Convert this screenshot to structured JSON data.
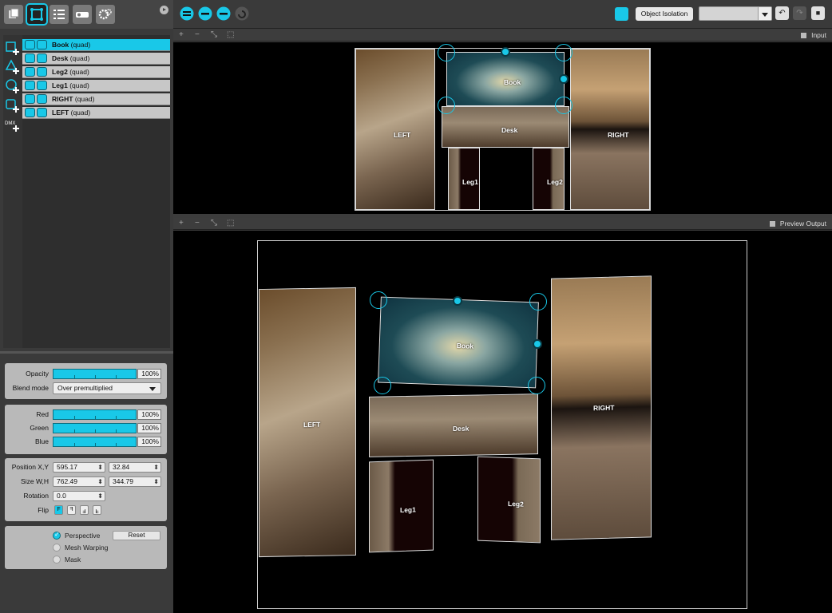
{
  "left_tabs": [
    {
      "icon": "layers-icon"
    },
    {
      "icon": "quad-mapping-icon",
      "active": true
    },
    {
      "icon": "list-icon"
    },
    {
      "icon": "projector-icon"
    },
    {
      "icon": "settings-icon"
    }
  ],
  "layers": [
    {
      "name": "Book",
      "type": "(quad)",
      "selected": true
    },
    {
      "name": "Desk",
      "type": "(quad)"
    },
    {
      "name": "Leg2",
      "type": "(quad)"
    },
    {
      "name": "Leg1",
      "type": "(quad)"
    },
    {
      "name": "RIGHT",
      "type": "(quad)"
    },
    {
      "name": "LEFT",
      "type": "(quad)"
    }
  ],
  "properties": {
    "opacity_label": "Opacity",
    "opacity_value": "100%",
    "blend_label": "Blend mode",
    "blend_value": "Over premultiplied",
    "red_label": "Red",
    "red_value": "100%",
    "green_label": "Green",
    "green_value": "100%",
    "blue_label": "Blue",
    "blue_value": "100%",
    "position_label": "Position X,Y",
    "position_x": "595.17",
    "position_y": "32.84",
    "size_label": "Size W,H",
    "size_w": "762.49",
    "size_h": "344.79",
    "rotation_label": "Rotation",
    "rotation_value": "0.0",
    "flip_label": "Flip",
    "flip_options": [
      "F",
      "F",
      "F",
      "F"
    ],
    "perspective_label": "Perspective",
    "perspective_checked": true,
    "reset_label": "Reset",
    "mesh_label": "Mesh Warping",
    "mask_label": "Mask"
  },
  "toolbar": {
    "isolation_label": "Object Isolation",
    "isolation_select": "",
    "undo": "↶",
    "redo": "↷",
    "lock": "🔒"
  },
  "input_view": {
    "label": "Input"
  },
  "output_view": {
    "label": "Preview Output"
  },
  "view_tools": [
    "+",
    "−",
    "⤡",
    "⬚"
  ],
  "quads_input": [
    {
      "label": "LEFT"
    },
    {
      "label": "Desk"
    },
    {
      "label": "Book"
    },
    {
      "label": "RIGHT"
    },
    {
      "label": "Leg1"
    },
    {
      "label": "Leg2"
    }
  ],
  "quads_output": [
    {
      "label": "LEFT"
    },
    {
      "label": "Desk"
    },
    {
      "label": "Book"
    },
    {
      "label": "RIGHT"
    },
    {
      "label": "Leg1"
    },
    {
      "label": "Leg2"
    }
  ],
  "colors": {
    "accent": "#19c8e8",
    "panel": "#3a3a3a",
    "group": "#b9b9b9"
  }
}
